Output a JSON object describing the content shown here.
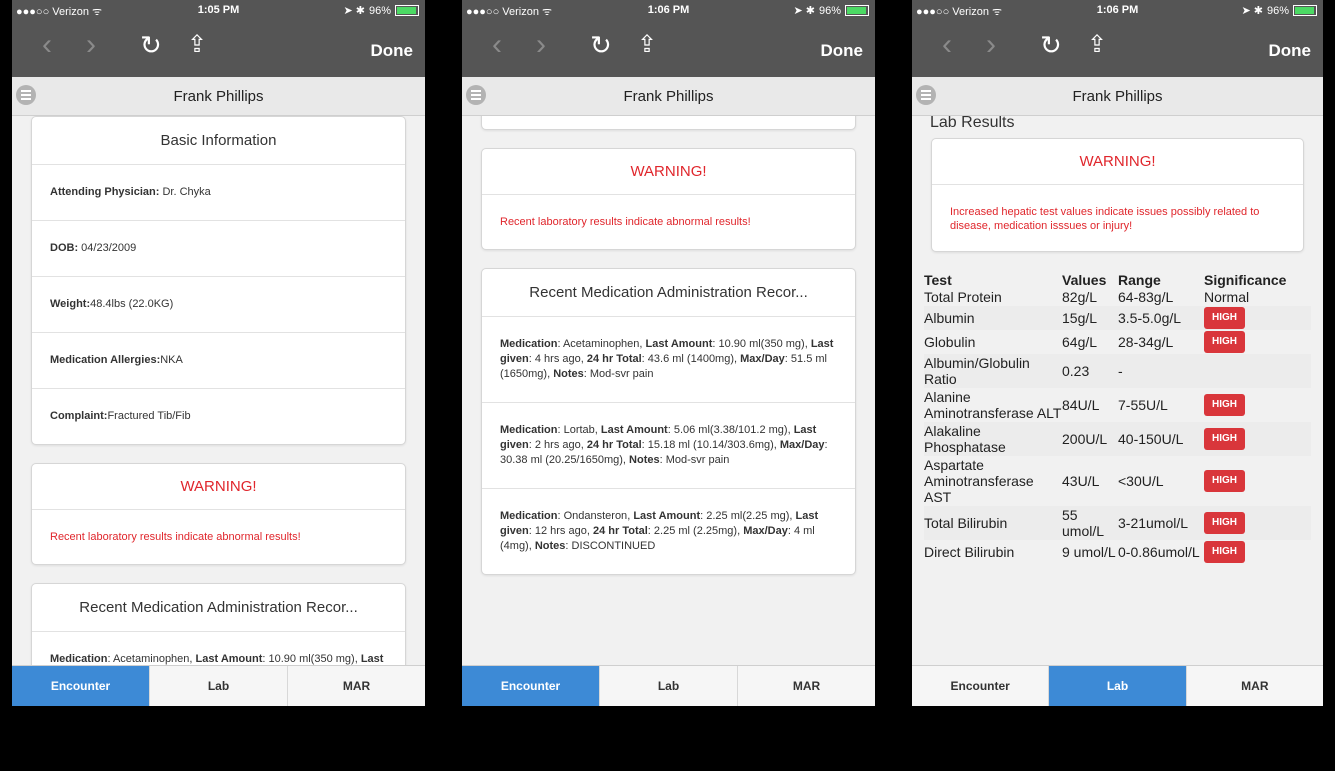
{
  "status": {
    "carrier": "●●●○○ Verizon ᯤ",
    "time1": "1:05 PM",
    "time2": "1:06 PM",
    "time3": "1:06 PM",
    "battery": "96%",
    "icons": "➤ ✱"
  },
  "nav": {
    "back": "‹",
    "forward": "›",
    "reload": "↻",
    "share": "⇪",
    "done": "Done"
  },
  "patient": {
    "name": "Frank Phillips"
  },
  "basic": {
    "header": "Basic Information",
    "physician_label": "Attending Physician:",
    "physician": " Dr. Chyka",
    "dob_label": "DOB:",
    "dob": " 04/23/2009",
    "weight_label": "Weight:",
    "weight": "48.4lbs (22.0KG)",
    "allergies_label": "Medication Allergies:",
    "allergies": "NKA",
    "complaint_label": "Complaint:",
    "complaint": "Fractured Tib/Fib"
  },
  "warning": {
    "header": "WARNING!",
    "text": "Recent laboratory results indicate abnormal results!"
  },
  "mar": {
    "header": "Recent Medication Administration Recor...",
    "items": [
      {
        "med": "Acetaminophen",
        "last_amount": "10.90 ml(350 mg)",
        "last_given": "4 hrs ago",
        "total": "43.6 ml (1400mg)",
        "max": "51.5 ml (1650mg)",
        "notes": "Mod-svr pain"
      },
      {
        "med": "Lortab",
        "last_amount": "5.06 ml(3.38/101.2 mg)",
        "last_given": "2 hrs ago",
        "total": "15.18 ml (10.14/303.6mg)",
        "max": "30.38 ml (20.25/1650mg)",
        "notes": "Mod-svr pain"
      },
      {
        "med": "Ondansteron",
        "last_amount": "2.25 ml(2.25 mg)",
        "last_given": "12 hrs ago",
        "total": "2.25 ml (2.25mg)",
        "max": "4 ml (4mg)",
        "notes": "DISCONTINUED"
      }
    ],
    "labels": {
      "med": "Medication",
      "last_amount": "Last Amount",
      "last_given": "Last given",
      "total": "24 hr Total",
      "max": "Max/Day",
      "notes": "Notes"
    }
  },
  "lab": {
    "title": "Lab Results",
    "warning_header": "WARNING!",
    "warning_text": "Increased hepatic test values indicate issues possibly related to disease, medication isssues or injury!",
    "columns": [
      "Test",
      "Values",
      "Range",
      "Significance"
    ],
    "rows": [
      {
        "test": "Total Protein",
        "value": "82g/L",
        "range": "64-83g/L",
        "sig": "Normal",
        "high": false
      },
      {
        "test": "Albumin",
        "value": "15g/L",
        "range": "3.5-5.0g/L",
        "sig": "HIGH",
        "high": true
      },
      {
        "test": "Globulin",
        "value": "64g/L",
        "range": "28-34g/L",
        "sig": "HIGH",
        "high": true
      },
      {
        "test": "Albumin/Globulin Ratio",
        "value": "0.23",
        "range": "-",
        "sig": "",
        "high": false
      },
      {
        "test": "Alanine Aminotransferase ALT",
        "value": "84U/L",
        "range": "7-55U/L",
        "sig": "HIGH",
        "high": true
      },
      {
        "test": "Alakaline Phosphatase",
        "value": "200U/L",
        "range": "40-150U/L",
        "sig": "HIGH",
        "high": true
      },
      {
        "test": "Aspartate Aminotransferase AST",
        "value": "43U/L",
        "range": "<30U/L",
        "sig": "HIGH",
        "high": true
      },
      {
        "test": "Total Bilirubin",
        "value": "55 umol/L",
        "range": "3-21umol/L",
        "sig": "HIGH",
        "high": true
      },
      {
        "test": "Direct Bilirubin",
        "value": "9 umol/L",
        "range": "0-0.86umol/L",
        "sig": "HIGH",
        "high": true
      }
    ]
  },
  "tabs": [
    "Encounter",
    "Lab",
    "MAR"
  ],
  "colors": {
    "nav_bg": "#555555",
    "tab_active": "#3d8ad6",
    "warning": "#e0262c",
    "high_badge": "#d9363b"
  }
}
